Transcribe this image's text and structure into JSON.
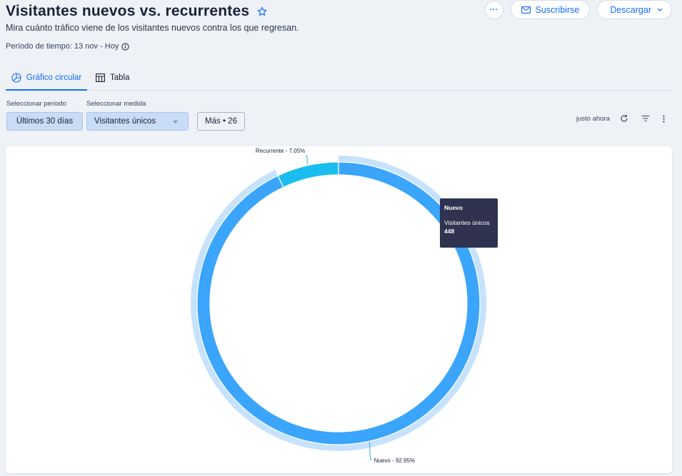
{
  "header": {
    "title": "Visitantes nuevos vs. recurrentes",
    "subtitle": "Mira cuánto tráfico viene de los visitantes nuevos contra los que regresan.",
    "period": "Período de tiempo: 13 nov - Hoy"
  },
  "actions": {
    "more_label": "···",
    "subscribe_label": "Suscribirse",
    "download_label": "Descargar"
  },
  "tabs": [
    {
      "label": "Gráfico circular",
      "active": true
    },
    {
      "label": "Tabla",
      "active": false
    }
  ],
  "filters": {
    "period_label": "Seleccionar periodo",
    "period_value": "Últimos 30 días",
    "measure_label": "Seleccionar medida",
    "measure_value": "Visitantes únicos",
    "more_label": "Más • 26"
  },
  "toolbar": {
    "updated_label": "justo ahora"
  },
  "tooltip": {
    "title": "Nuevo",
    "measure": "Visitantes únicos",
    "value": "448"
  },
  "colors": {
    "accent": "#116dff",
    "nuevo": "#3aa5fb",
    "recurrente": "#1bbdf0",
    "hover_ring": "#c6e2fd"
  },
  "chart_data": {
    "type": "pie",
    "donut": true,
    "labels": [
      "Nuevo",
      "Recurrente"
    ],
    "values": [
      92.95,
      7.05
    ],
    "data_labels": [
      "Nuevo - 92.95%",
      "Recurrente - 7.05%"
    ],
    "highlighted": "Nuevo"
  }
}
